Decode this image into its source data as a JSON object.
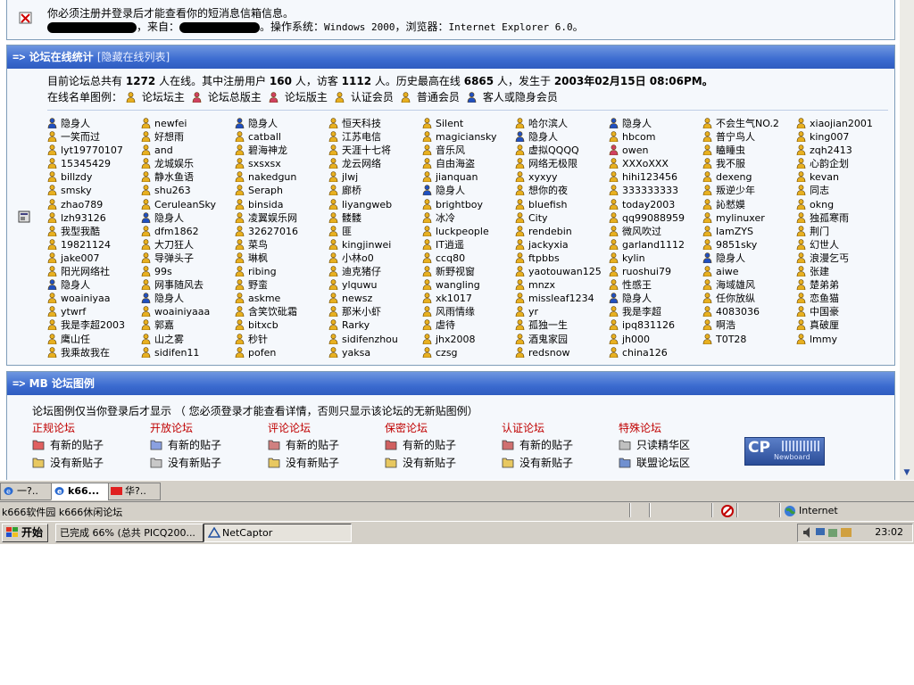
{
  "notice": {
    "message": "你必须注册并登录后才能查看你的短消息信箱信息。",
    "from_label": "，来自：",
    "os_label": "。操作系统：",
    "os_value": "Windows 2000",
    "browser_label": "，浏览器：",
    "browser_value": "Internet Explorer 6.0",
    "end": "。"
  },
  "online": {
    "header": "论坛在线统计",
    "header_link": "[隐藏在线列表]",
    "stats": {
      "p1": "目前论坛总共有",
      "total": "1272",
      "p2": "人在线。其中注册用户",
      "registered": "160",
      "p3": "人，访客",
      "guests": "1112",
      "p4": "人。历史最高在线",
      "record": "6865",
      "p5": "人，发生于",
      "record_time": "2003年02月15日 08:06PM。"
    },
    "legend_label": "在线名单图例：",
    "legend": [
      {
        "label": "论坛坛主",
        "icon": "admin-icon"
      },
      {
        "label": "论坛总版主",
        "icon": "super-moderator-icon"
      },
      {
        "label": "论坛版主",
        "icon": "moderator-icon"
      },
      {
        "label": "认证会员",
        "icon": "verified-member-icon"
      },
      {
        "label": "普通会员",
        "icon": "member-icon"
      },
      {
        "label": "客人或隐身会员",
        "icon": "guest-icon"
      }
    ],
    "users": [
      [
        "隐身人",
        "一笑而过",
        "lyt19770107",
        "15345429",
        "billzdy",
        "smsky",
        "zhao789",
        "lzh93126",
        "我型我酷",
        "19821124",
        "jake007",
        "阳光网络社",
        "隐身人",
        "woainiyaa",
        "ytwrf",
        "我是李超2003",
        "鹰山任",
        "我乘故我在"
      ],
      [
        "newfei",
        "好想雨",
        "and",
        "龙城娱乐",
        "静水鱼语",
        "shu263",
        "CeruleanSky",
        "隐身人",
        "dfm1862",
        "大刀狂人",
        "导弹头子",
        "99s",
        "网事随风去",
        "隐身人",
        "woainiyaaa",
        "郭嘉",
        "山之雾",
        "sidifen11"
      ],
      [
        "隐身人",
        "catball",
        "碧海神龙",
        "sxsxsx",
        "nakedgun",
        "Seraph",
        "binsida",
        "凌翼娱乐网",
        "32627016",
        "菜鸟",
        "琳枫",
        "ribing",
        "野蛮",
        "askme",
        "含笑饮砒霜",
        "bitxcb",
        "秒针",
        "pofen"
      ],
      [
        "恒天科技",
        "江苏电信",
        "天涯十七将",
        "龙云网络",
        "jlwj",
        "廊桥",
        "liyangweb",
        "髅髅",
        "匪",
        "kingjinwei",
        "小林o0",
        "迪克猪仔",
        "ylquwu",
        "newsz",
        "那米小虾",
        "Rarky",
        "sidifenzhou",
        "yaksa"
      ],
      [
        "Silent",
        "magiciansky",
        "音乐风",
        "自由海盗",
        "jianquan",
        "隐身人",
        "brightboy",
        "冰冷",
        "luckpeople",
        "IT逍遥",
        "ccq80",
        "新野视窗",
        "wangling",
        "xk1017",
        "风雨情缘",
        "虐待",
        "jhx2008",
        "czsg"
      ],
      [
        "哈尔滨人",
        "隐身人",
        "虚拟QQQQ",
        "网络无极限",
        "xyxyy",
        "想你的夜",
        "bluefish",
        "City",
        "rendebin",
        "jackyxia",
        "ftpbbs",
        "yaotouwan125",
        "mnzx",
        "missleaf1234",
        "yr",
        "孤独一生",
        "酒鬼家园",
        "redsnow"
      ],
      [
        "隐身人",
        "hbcom",
        "owen",
        "XXXoXXX",
        "hihi123456",
        "333333333",
        "today2003",
        "qq99088959",
        "微风吹过",
        "garland1112",
        "kylin",
        "ruoshui79",
        "性感王",
        "隐身人",
        "我是李超",
        "ipq831126",
        "jh000",
        "china126"
      ],
      [
        "不会生气NO.2",
        "普宁鸟人",
        "瞌睡虫",
        "我不服",
        "dexeng",
        "叛逆少年",
        "訫憖嫫",
        "mylinuxer",
        "IamZYS",
        "9851sky",
        "隐身人",
        "aiwe",
        "海域雄风",
        "任你放纵",
        "4083036",
        "啊浩",
        "T0T28"
      ],
      [
        "xiaojian2001",
        "king007",
        "zqh2413",
        "心韵企划",
        "kevan",
        "同志",
        "okng",
        "独孤寒雨",
        "荆门",
        "幻世人",
        "浪漫乞丐",
        "张建",
        "楚弟弟",
        "恋鱼猫",
        "中国豪",
        "真破厘",
        "lmmy"
      ]
    ],
    "user_icons": [
      [
        "guest",
        "member",
        "member",
        "member",
        "member",
        "member",
        "member",
        "member",
        "member",
        "member",
        "member",
        "member",
        "guest",
        "member",
        "member",
        "member",
        "member",
        "member"
      ],
      [
        "member",
        "member",
        "member",
        "member",
        "member",
        "member",
        "member",
        "guest",
        "member",
        "member",
        "member",
        "member",
        "member",
        "guest",
        "member",
        "member",
        "member",
        "member"
      ],
      [
        "guest",
        "member",
        "member",
        "member",
        "member",
        "member",
        "member",
        "member",
        "member",
        "member",
        "member",
        "member",
        "member",
        "member",
        "member",
        "member",
        "member",
        "member"
      ],
      [
        "member",
        "member",
        "member",
        "member",
        "member",
        "member",
        "member",
        "member",
        "member",
        "member",
        "member",
        "member",
        "member",
        "member",
        "member",
        "member",
        "member",
        "member"
      ],
      [
        "member",
        "member",
        "member",
        "member",
        "member",
        "guest",
        "member",
        "member",
        "member",
        "member",
        "member",
        "member",
        "member",
        "member",
        "member",
        "member",
        "member",
        "member"
      ],
      [
        "member",
        "guest",
        "member",
        "member",
        "member",
        "member",
        "member",
        "member",
        "member",
        "member",
        "member",
        "member",
        "member",
        "member",
        "member",
        "member",
        "member",
        "member"
      ],
      [
        "guest",
        "member",
        "moderator",
        "member",
        "member",
        "member",
        "member",
        "member",
        "member",
        "member",
        "member",
        "member",
        "member",
        "guest",
        "member",
        "member",
        "member",
        "member"
      ],
      [
        "member",
        "member",
        "member",
        "member",
        "member",
        "member",
        "member",
        "member",
        "member",
        "member",
        "guest",
        "member",
        "member",
        "member",
        "member",
        "member",
        "member"
      ],
      [
        "member",
        "member",
        "member",
        "member",
        "member",
        "member",
        "member",
        "member",
        "member",
        "member",
        "member",
        "member",
        "member",
        "member",
        "member",
        "member",
        "member"
      ]
    ]
  },
  "legend_panel": {
    "header": "MB 论坛图例",
    "desc": "论坛图例仅当你登录后才显示 （ 您必须登录才能查看详情，否则只显示该论坛的无新贴图例）",
    "categories": [
      {
        "title": "正规论坛",
        "items": [
          "有新的贴子",
          "没有新贴子"
        ],
        "colors": [
          "#e06060",
          "#e8c860"
        ]
      },
      {
        "title": "开放论坛",
        "items": [
          "有新的贴子",
          "没有新贴子"
        ],
        "colors": [
          "#8aa0e0",
          "#c8c8c8"
        ]
      },
      {
        "title": "评论论坛",
        "items": [
          "有新的贴子",
          "没有新贴子"
        ],
        "colors": [
          "#d08080",
          "#e8c860"
        ]
      },
      {
        "title": "保密论坛",
        "items": [
          "有新的贴子",
          "没有新贴子"
        ],
        "colors": [
          "#d06060",
          "#e8c860"
        ]
      },
      {
        "title": "认证论坛",
        "items": [
          "有新的贴子",
          "没有新贴子"
        ],
        "colors": [
          "#d07070",
          "#e8c860"
        ]
      },
      {
        "title": "特殊论坛",
        "items": [
          "只读精华区",
          "联盟论坛区"
        ],
        "colors": [
          "#c0c0c0",
          "#7090d0"
        ]
      }
    ],
    "logo_text": "CP",
    "logo_sub": "Newboard"
  },
  "tabs": [
    {
      "label": "一?..",
      "active": false,
      "icon": "ie-icon"
    },
    {
      "label": "k66...",
      "active": true,
      "icon": "ie-icon"
    },
    {
      "label": "华?..",
      "active": false,
      "icon": "red-flag-icon"
    }
  ],
  "status": {
    "text": "k666软件园 k666休闲论坛",
    "zone": "Internet"
  },
  "taskbar": {
    "start": "开始",
    "buttons": [
      {
        "label": "已完成 66% (总共 PICQ200...",
        "pressed": false
      },
      {
        "label": "NetCaptor",
        "pressed": true
      }
    ],
    "clock": "23:02"
  },
  "colors": {
    "header_blue": "#3b6bd0",
    "panel_bg": "#f5f8fc",
    "category_red": "#c00000"
  }
}
